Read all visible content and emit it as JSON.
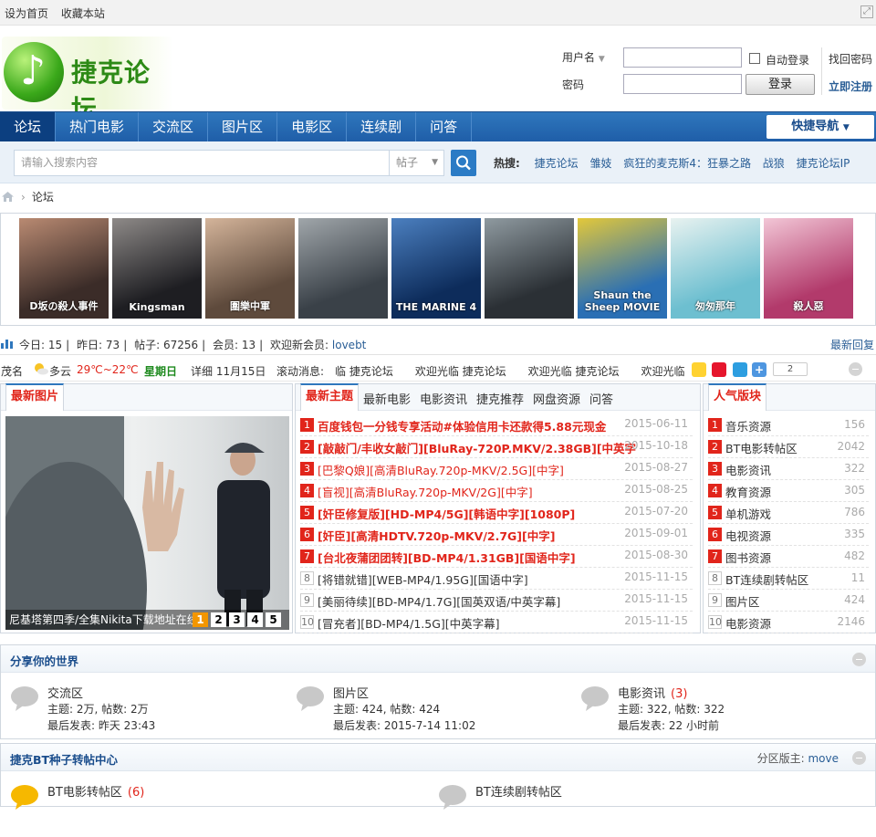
{
  "topbar": {
    "set_home": "设为首页",
    "bookmark": "收藏本站"
  },
  "site": {
    "logo_text": "捷克论坛"
  },
  "login": {
    "username_label": "用户名",
    "password_label": "密码",
    "auto_login": "自动登录",
    "login_button": "登录",
    "forgot_password": "找回密码",
    "register": "立即注册"
  },
  "nav": {
    "items": [
      "论坛",
      "热门电影",
      "交流区",
      "图片区",
      "电影区",
      "连续剧",
      "问答"
    ],
    "quick_nav": "快捷导航"
  },
  "search": {
    "placeholder": "请输入搜索内容",
    "type": "帖子",
    "hot_label": "热搜:",
    "hot_items": [
      "捷克论坛",
      "雏妓",
      "疯狂的麦克斯4：狂暴之路",
      "战狼",
      "捷克论坛IP"
    ]
  },
  "breadcrumb": {
    "current": "论坛"
  },
  "posters": [
    {
      "title": "D坂の殺人事件",
      "c1": "#3b2c28",
      "c2": "#b98a72"
    },
    {
      "title": "Kingsman",
      "c1": "#1e1e22",
      "c2": "#8e8a88"
    },
    {
      "title": "圍樂中軍",
      "c1": "#5e4a3c",
      "c2": "#d4b49a"
    },
    {
      "title": "",
      "c1": "#3a4148",
      "c2": "#a0a6aa"
    },
    {
      "title": "THE MARINE 4",
      "c1": "#0d2c5b",
      "c2": "#4b7fbf"
    },
    {
      "title": "",
      "c1": "#2b3035",
      "c2": "#8f9aa0"
    },
    {
      "title": "Shaun the Sheep MOVIE",
      "c1": "#2a6fb4",
      "c2": "#e3c83a"
    },
    {
      "title": "匆匆那年",
      "c1": "#6dbfd0",
      "c2": "#e8f2f0"
    },
    {
      "title": "殺人惡",
      "c1": "#b23a6b",
      "c2": "#f2c6d6"
    }
  ],
  "stats": {
    "today_label": "今日:",
    "today": "15",
    "yesterday_label": "昨日:",
    "yesterday": "73",
    "posts_label": "帖子:",
    "posts": "67256",
    "members_label": "会员:",
    "members": "13",
    "welcome_label": "欢迎新会员:",
    "newest_member": "lovebt",
    "latest_reply": "最新回复"
  },
  "ticker": {
    "city": "茂名",
    "weather": "多云",
    "temp": "29℃~22℃",
    "weekday": "星期日",
    "date": "详细 11月15日",
    "scroll_label": "滚动消息:",
    "scroll_text": "临 捷克论坛　　欢迎光临 捷克论坛　　欢迎光临 捷克论坛　　欢迎光临",
    "share_count": "2"
  },
  "focus": {
    "tab": "最新图片",
    "caption": "尼基塔第四季/全集Nikita下载地址在线",
    "pages": [
      "1",
      "2",
      "3",
      "4",
      "5"
    ]
  },
  "threads": {
    "tabs": [
      "最新主题",
      "最新电影",
      "电影资讯",
      "捷克推荐",
      "网盘资源",
      "问答"
    ],
    "items": [
      {
        "n": "1",
        "title": "百度钱包一分钱专享活动#体验信用卡还款得5.88元现金",
        "date": "2015-06-11",
        "style": "red"
      },
      {
        "n": "2",
        "title": "[敲敲门/丰收女敲门][BluRay-720P.MKV/2.38GB][中英字",
        "date": "2015-10-18",
        "style": "red"
      },
      {
        "n": "3",
        "title": "[巴黎Q娘][高清BluRay.720p-MKV/2.5G][中字]",
        "date": "2015-08-27",
        "style": "redn"
      },
      {
        "n": "4",
        "title": "[盲视][高清BluRay.720p-MKV/2G][中字]",
        "date": "2015-08-25",
        "style": "redn"
      },
      {
        "n": "5",
        "title": "[奸臣修复版][HD-MP4/5G][韩语中字][1080P]",
        "date": "2015-07-20",
        "style": "red"
      },
      {
        "n": "6",
        "title": "[奸臣][高清HDTV.720p-MKV/2.7G][中字]",
        "date": "2015-09-01",
        "style": "red"
      },
      {
        "n": "7",
        "title": "[台北夜蒲团团转][BD-MP4/1.31GB][国语中字]",
        "date": "2015-08-30",
        "style": "red"
      },
      {
        "n": "8",
        "title": "[将错就错][WEB-MP4/1.95G][国语中字]",
        "date": "2015-11-15",
        "style": "normal"
      },
      {
        "n": "9",
        "title": "[美丽待续][BD-MP4/1.7G][国英双语/中英字幕]",
        "date": "2015-11-15",
        "style": "normal"
      },
      {
        "n": "10",
        "title": "[冒充者][BD-MP4/1.5G][中英字幕]",
        "date": "2015-11-15",
        "style": "normal"
      }
    ]
  },
  "hot_boards": {
    "tab": "人气版块",
    "items": [
      {
        "n": "1",
        "name": "音乐资源",
        "count": "156"
      },
      {
        "n": "2",
        "name": "BT电影转帖区",
        "count": "2042"
      },
      {
        "n": "3",
        "name": "电影资讯",
        "count": "322"
      },
      {
        "n": "4",
        "name": "教育资源",
        "count": "305"
      },
      {
        "n": "5",
        "name": "单机游戏",
        "count": "786"
      },
      {
        "n": "6",
        "name": "电视资源",
        "count": "335"
      },
      {
        "n": "7",
        "name": "图书资源",
        "count": "482"
      },
      {
        "n": "8",
        "name": "BT连续剧转帖区",
        "count": "11"
      },
      {
        "n": "9",
        "name": "图片区",
        "count": "424"
      },
      {
        "n": "10",
        "name": "电影资源",
        "count": "2146"
      }
    ]
  },
  "categories": [
    {
      "title": "分享你的世界",
      "forums": [
        {
          "name": "交流区",
          "new": "",
          "stats": "主题: 2万, 帖数: 2万",
          "last": "最后发表: 昨天 23:43"
        },
        {
          "name": "图片区",
          "new": "",
          "stats": "主题: 424, 帖数: 424",
          "last": "最后发表: 2015-7-14 11:02"
        },
        {
          "name": "电影资讯",
          "new": "(3)",
          "stats": "主题: 322, 帖数: 322",
          "last": "最后发表: 22 小时前"
        }
      ]
    },
    {
      "title": "捷克BT种子转帖中心",
      "moderator_label": "分区版主:",
      "moderator": "move",
      "forums": [
        {
          "name": "BT电影转帖区",
          "new": "(6)"
        },
        {
          "name": "BT连续剧转帖区",
          "new": ""
        }
      ]
    }
  ]
}
